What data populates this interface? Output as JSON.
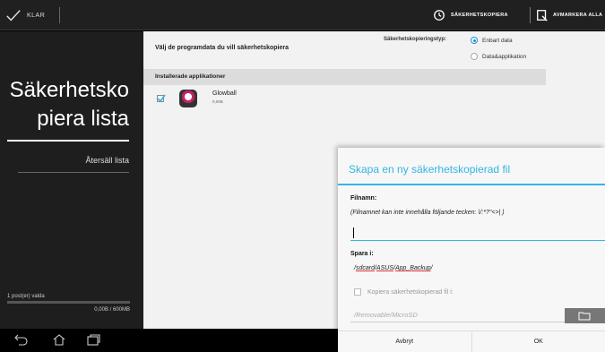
{
  "actionbar": {
    "done_label": "KLAR",
    "backup_label": "SÄKERHETSKOPIERA",
    "unmark_label": "AVMARKERA ALLA"
  },
  "left_panel": {
    "title": "Säkerhetsko piera lista",
    "reset_label": "Återsäll lista",
    "selected_count": "1 post(er) valda",
    "size_text": "0,00B / 600MB",
    "progress_fraction": 0
  },
  "main": {
    "prompt": "Välj de programdata du vill säkerhetskopiera",
    "backup_type_label": "Säkerhetskopieringstyp:",
    "backup_options": [
      {
        "label": "Enbart data",
        "selected": true
      },
      {
        "label": "Data&applikation",
        "selected": false
      }
    ],
    "apps_header": "Installerade applikationer",
    "apps": [
      {
        "name": "Glowball",
        "size": "0,00B",
        "checked": true
      }
    ]
  },
  "dialog": {
    "title": "Skapa en ny säkerhetskopierad fil",
    "filename_label": "Filnamn:",
    "filename_hint": "(Filnamnet kan inte innehålla följande tecken: \\/:*?\"<>| )",
    "filename_value": "",
    "save_label": "Spara i:",
    "save_path_prefix": "/",
    "save_path_1": "sdcard",
    "save_path_sep1": "/",
    "save_path_2": "ASUS",
    "save_path_sep2": "/",
    "save_path_3": "App_Backup",
    "save_path_suffix": "/",
    "copy_label": "Kopiera säkerhetskopierad fil i:",
    "copy_path": "/Removable/MicroSD",
    "cancel_label": "Avbryt",
    "ok_label": "OK"
  },
  "colors": {
    "accent": "#33b5e5",
    "actionbar": "#202020",
    "left_panel": "#1e1e1e"
  }
}
